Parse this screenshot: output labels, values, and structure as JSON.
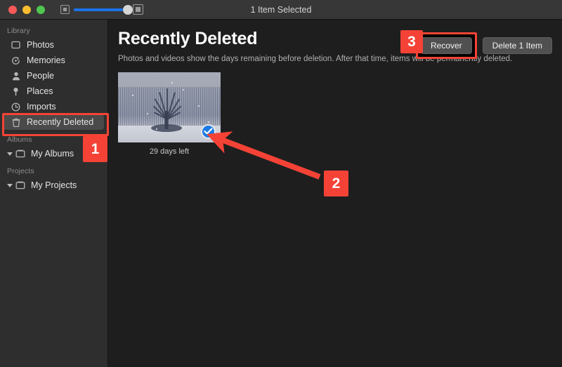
{
  "window": {
    "title": "1 Item Selected",
    "traffic_lights": [
      "close-red",
      "minimize-yellow",
      "maximize-green"
    ],
    "zoom_slider": {
      "small_icon": "small-thumbnail-icon",
      "large_icon": "large-thumbnail-icon",
      "value": 92
    }
  },
  "sidebar": {
    "sections": [
      {
        "label": "Library",
        "items": [
          {
            "label": "Photos",
            "icon": "photos-icon",
            "selected": false
          },
          {
            "label": "Memories",
            "icon": "memories-icon",
            "selected": false
          },
          {
            "label": "People",
            "icon": "people-icon",
            "selected": false
          },
          {
            "label": "Places",
            "icon": "places-icon",
            "selected": false
          },
          {
            "label": "Imports",
            "icon": "imports-icon",
            "selected": false
          },
          {
            "label": "Recently Deleted",
            "icon": "trash-icon",
            "selected": true
          }
        ]
      },
      {
        "label": "Albums",
        "items": [
          {
            "label": "My Albums",
            "icon": "album-icon",
            "selected": false,
            "disclosure": true
          }
        ]
      },
      {
        "label": "Projects",
        "items": [
          {
            "label": "My Projects",
            "icon": "project-icon",
            "selected": false,
            "disclosure": true
          }
        ]
      }
    ]
  },
  "main": {
    "title": "Recently Deleted",
    "subtitle": "Photos and videos show the days remaining before deletion. After that time, items will be permanently deleted.",
    "recover_button": "Recover",
    "delete_button": "Delete 1 Item",
    "photos": [
      {
        "caption": "29 days left",
        "selected": true,
        "alt": "snowy-field-with-bare-tree"
      }
    ]
  },
  "annotations": {
    "badge_1": "1",
    "badge_2": "2",
    "badge_3": "3",
    "highlight_color": "#f44336",
    "arrow": "red-arrow-pointing-to-selection-checkmark"
  },
  "colors": {
    "accent_blue": "#1b7ce8",
    "annotation_red": "#f44336",
    "sidebar_bg": "#2e2e2e",
    "content_bg": "#1e1e1e",
    "titlebar_bg": "#373737"
  }
}
